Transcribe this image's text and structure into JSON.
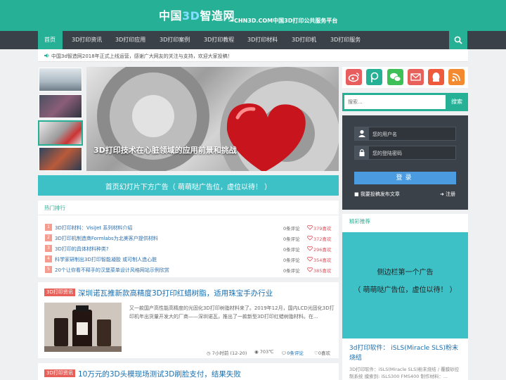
{
  "header": {
    "logo_a": "中国",
    "logo_b": "3D",
    "logo_c": "智造网",
    "tagline": "—CHN3D.COM中国3D打印公共服务平台"
  },
  "nav": {
    "items": [
      "首页",
      "3D打印资讯",
      "3D打印应用",
      "3D打印案例",
      "3D打印教程",
      "3D打印材料",
      "3D打印机",
      "3D打印服务"
    ],
    "search_icon": "search-icon"
  },
  "notice": {
    "icon": "speaker-icon",
    "text": "中国3d智造网2018年正式上线运营，感谢广大网友的关注与支持，欢迎大家投稿！"
  },
  "slider": {
    "caption": "3D打印技术在心脏领域的应用前景和挑战",
    "thumb_count": 4,
    "active_thumb": 3
  },
  "ad_banner": {
    "text": "首页幻灯片下方广告（ 萌萌哒广告位，虚位以待！ ）"
  },
  "hot": {
    "title": "热门排行",
    "items": [
      {
        "num": "1",
        "text": "3D打印材料：VisiJet 系列材料介绍",
        "comments": "0条评论",
        "likes": "379喜欢"
      },
      {
        "num": "2",
        "text": "3D打印机制造商Formlabs为北美客户提供材料",
        "comments": "0条评论",
        "likes": "372喜欢"
      },
      {
        "num": "3",
        "text": "3D打印的具体材料种类?",
        "comments": "0条评论",
        "likes": "296喜欢"
      },
      {
        "num": "4",
        "text": "科学家研制出3D打印智能凝胶 或可制人造心脏",
        "comments": "0条评论",
        "likes": "354喜欢"
      },
      {
        "num": "5",
        "text": "20个让你看不释手的汉堡菜单设计风格网站示例欣赏",
        "comments": "0条评论",
        "likes": "385喜欢"
      }
    ]
  },
  "articles": [
    {
      "category": "3D打印资讯",
      "title": "深圳诺瓦推新款高精度3D打印红蜡树脂，适用珠宝手办行业",
      "desc": "又一款国产高性能高精度的光固化3D打印树脂材料来了。2019年12月，国内LCD光固化3D打印机年出货量开发大的厂商——深圳诺瓦，推出了一款新型3D打印红蜡树脂材料。在...",
      "time": "7小时前 (12-20)",
      "views": "703℃",
      "comments": "0条评论",
      "likes": "0喜欢"
    },
    {
      "category": "3D打印资讯",
      "title": "10万元的3D头模现场测试3D刷脸支付，结果失败"
    }
  ],
  "sidebar": {
    "social_icons": [
      "weibo-icon",
      "qzone-icon",
      "wechat-icon",
      "mail-icon",
      "qq-icon",
      "rss-icon"
    ],
    "search_placeholder": "搜索...",
    "search_button": "搜索",
    "username_placeholder": "您的用户名",
    "password_placeholder": "您的登陆密码",
    "login_button": "登录",
    "submit_link": "我要投稿发布文章",
    "register_link": "注册",
    "featured_title": "精彩推荐",
    "featured_ad_line1": "侧边栏第一个广告",
    "featured_ad_line2": "（ 萌萌哒广告位，虚位以待！ ）",
    "article_title": "3d打印软件： iSLS(Miracle SLS)粉末烧结",
    "article_desc": "3D打印软件：iSLS(Miracle SLS)粉末烧结 / 覆膜砂控制系统 摸索到: iSLS300 FMS400 制作材料：..."
  },
  "colors": {
    "brand": "#26b197",
    "nav": "#3a4149",
    "ad": "#3dc1c7",
    "link": "#1a6fb0",
    "tag": "#e8605a"
  }
}
